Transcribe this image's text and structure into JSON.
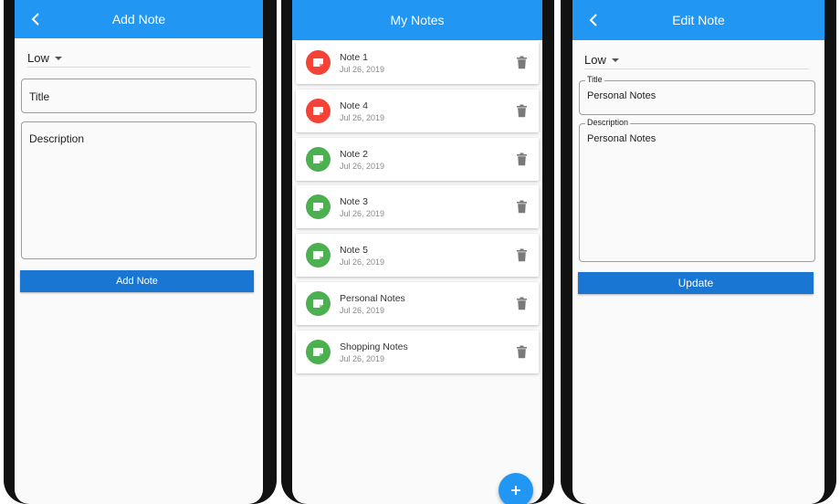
{
  "colors": {
    "primary": "#2196f3",
    "button": "#1976d2",
    "priority_high": "#f44336",
    "priority_low": "#4caf50"
  },
  "add_note": {
    "title": "Add Note",
    "priority": "Low",
    "title_placeholder": "Title",
    "description_placeholder": "Description",
    "button_label": "Add Note"
  },
  "my_notes": {
    "title": "My Notes",
    "notes": [
      {
        "title": "Note 1",
        "date": "Jul 26, 2019",
        "priority": "high"
      },
      {
        "title": "Note 4",
        "date": "Jul 26, 2019",
        "priority": "high"
      },
      {
        "title": "Note 2",
        "date": "Jul 26, 2019",
        "priority": "low"
      },
      {
        "title": "Note 3",
        "date": "Jul 26, 2019",
        "priority": "low"
      },
      {
        "title": "Note 5",
        "date": "Jul 26, 2019",
        "priority": "low"
      },
      {
        "title": "Personal Notes",
        "date": "Jul 26, 2019",
        "priority": "low"
      },
      {
        "title": "Shopping Notes",
        "date": "Jul 26, 2019",
        "priority": "low"
      }
    ],
    "fab_label": "+"
  },
  "edit_note": {
    "title": "Edit Note",
    "priority": "Low",
    "title_label": "Title",
    "title_value": "Personal Notes",
    "description_label": "Description",
    "description_value": "Personal Notes",
    "button_label": "Update"
  },
  "icons": {
    "back": "chevron-left-icon",
    "note": "note-icon",
    "delete": "trash-icon",
    "add": "plus-icon"
  }
}
